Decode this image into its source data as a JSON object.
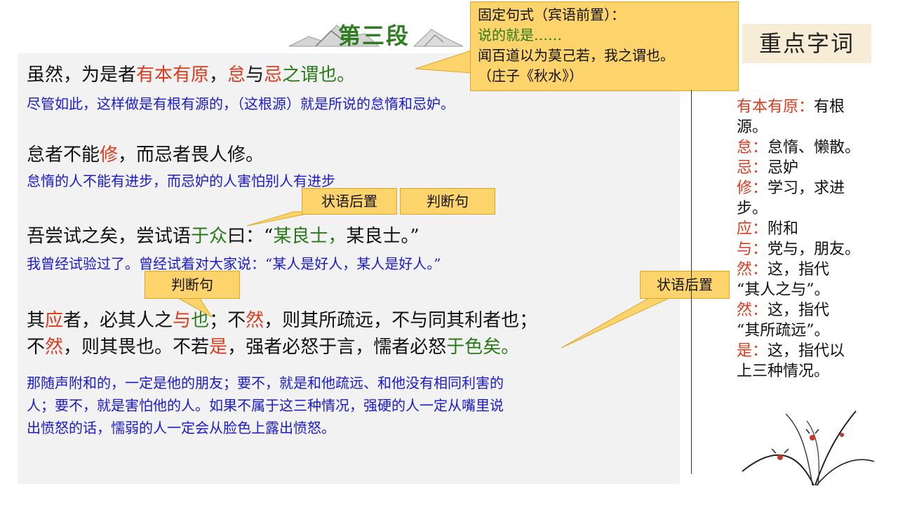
{
  "title": "第三段",
  "callout_top": {
    "line1": "固定句式（宾语前置）：",
    "line2": "说的就是……",
    "line3": "闻百道以为莫己若，我之谓也。",
    "line4": "（庄子《秋水》）"
  },
  "section_title": "重点字词",
  "tags": {
    "zhuangyu1": "状语后置",
    "panduan1": "判断句",
    "panduan2": "判断句",
    "zhuangyu2": "状语后置"
  },
  "p1": {
    "a": "虽然，为是者",
    "b": "有本有原",
    "c": "，",
    "d": "怠",
    "e": "与",
    "f": "忌",
    "g": "之谓也。",
    "trans": "尽管如此，这样做是有根有源的，（这根源）就是所说的怠惰和忌妒。"
  },
  "p2": {
    "a": "怠者不能",
    "b": "修",
    "c": "，而忌者畏人修。",
    "trans": "怠惰的人不能有进步，而忌妒的人害怕别人有进步"
  },
  "p3": {
    "a": "吾尝试之矣，尝试语",
    "b": "于众",
    "c": "曰：“",
    "d": "某良士，",
    "e": "某良士。”",
    "trans": "我曾经试验过了。曾经试着对大家说：“某人是好人，某人是好人。”"
  },
  "p4": {
    "a": "其",
    "b": "应",
    "c": "者，必其人之",
    "d": "与",
    "e": "也",
    "f": "；不",
    "g": "然",
    "h": "，则其所疏远，不与同其利者也；",
    "i": "不",
    "j": "然",
    "k": "，则其畏也。不若",
    "l": "是",
    "m": "，强者必怒于言，懦者必怒",
    "n": "于色矣。",
    "trans1": "那随声附和的，一定是他的朋友；要不，就是和他疏远、和他没有相同利害的",
    "trans2": "人；要不，就是害怕他的人。如果不属于这三种情况，强硬的人一定从嘴里说",
    "trans3": "出愤怒的话，懦弱的人一定会从脸色上露出愤怒。"
  },
  "notes": [
    {
      "k": "有本有原：",
      "v": "有根",
      "v2": "源。"
    },
    {
      "k": "怠：",
      "v": "怠惰、懒散。",
      "v2": ""
    },
    {
      "k": "忌：",
      "v": "忌妒",
      "v2": ""
    },
    {
      "k": "修：",
      "v": "学习，求进",
      "v2": "步。"
    },
    {
      "k": "应：",
      "v": "附和",
      "v2": ""
    },
    {
      "k": "与：",
      "v": "党与，朋友。",
      "v2": ""
    },
    {
      "k": "然：",
      "v": "这，指代",
      "v2": "“其人之与”。"
    },
    {
      "k": "然：",
      "v": "这，指代",
      "v2": "“其所疏远”。"
    },
    {
      "k": "是：",
      "v": "这，指代以",
      "v2": "上三种情况。"
    }
  ],
  "colors": {
    "red": "#e03a1e",
    "green": "#2a7a1a",
    "blue": "#1a1ad0",
    "callout": "#fdd36b"
  },
  "icons": [
    "mountain-ink-decoration",
    "orchid-ink-decoration"
  ]
}
